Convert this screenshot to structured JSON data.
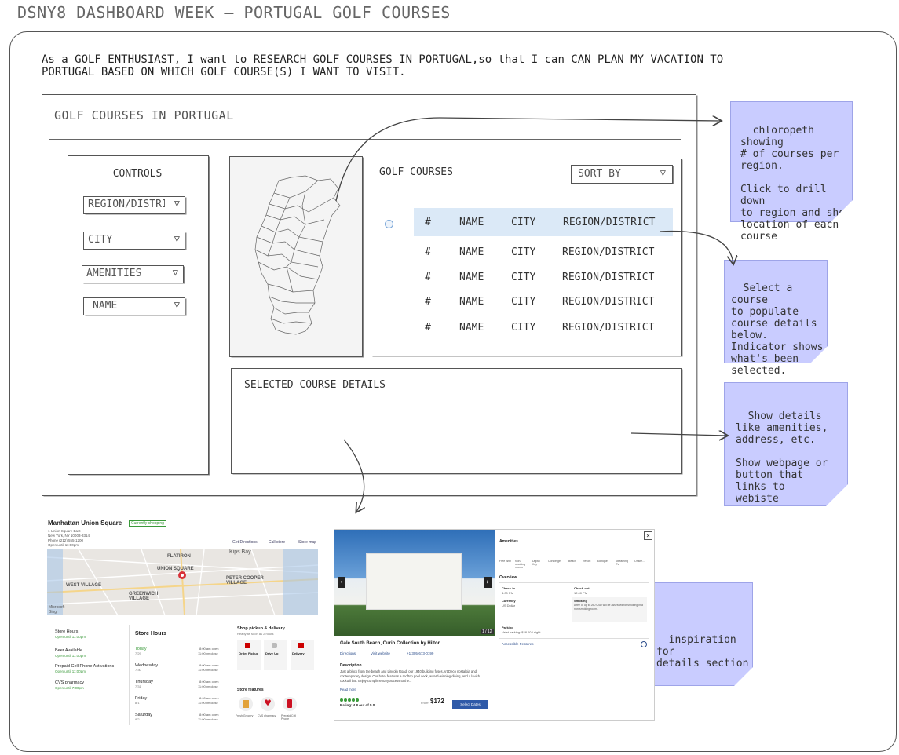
{
  "page_title": "DSNY8 DASHBOARD WEEK – PORTUGAL GOLF COURSES",
  "user_story": "As a GOLF ENTHUSIAST, I want to RESEARCH GOLF COURSES IN PORTUGAL,so that I can CAN PLAN MY VACATION TO\nPORTUGAL BASED ON WHICH GOLF COURSE(S) I WANT TO VISIT.",
  "dashboard": {
    "title": "GOLF COURSES IN PORTUGAL",
    "controls": {
      "title": "CONTROLS",
      "dropdowns": [
        "REGION/DISTRICT",
        "CITY",
        "AMENITIES",
        "NAME"
      ]
    },
    "courses": {
      "title": "GOLF COURSES",
      "sort_label": "SORT BY",
      "columns": [
        "#",
        "NAME",
        "CITY",
        "REGION/DISTRICT"
      ],
      "rows": [
        [
          "#",
          "NAME",
          "CITY",
          "REGION/DISTRICT"
        ],
        [
          "#",
          "NAME",
          "CITY",
          "REGION/DISTRICT"
        ],
        [
          "#",
          "NAME",
          "CITY",
          "REGION/DISTRICT"
        ],
        [
          "#",
          "NAME",
          "CITY",
          "REGION/DISTRICT"
        ],
        [
          "#",
          "NAME",
          "CITY",
          "REGION/DISTRICT"
        ]
      ],
      "selected_row": 0
    },
    "details_title": "SELECTED COURSE DETAILS"
  },
  "notes": {
    "map": "chloropeth showing\n# of courses per\nregion.\n\nClick to drill down\nto region and show\nlocation of each\ncourse",
    "select": "Select a course\nto populate\ncourse details\nbelow.\nIndicator shows\nwhat's been\nselected.",
    "details": "Show details\nlike amenities,\naddress, etc.\n\nShow webpage or\nbutton that\nlinks to\nwebiste",
    "inspiration": "inspiration for\ndetails section"
  },
  "inspiration_store": {
    "title": "Manhattan Union Square",
    "badge": "Currently shopping",
    "address": [
      "1 Union Square East",
      "New York, NY 10003-3314",
      "Phone (212) 555-1200",
      "Open until 11:00pm"
    ],
    "actions": [
      "Get Directions",
      "Call store",
      "Store map"
    ],
    "map_labels": [
      "Kips Bay",
      "FLATIRON",
      "UNION SQUARE",
      "PETER COOPER VILLAGE",
      "WEST VILLAGE",
      "GREENWICH VILLAGE",
      "Microsoft Bing"
    ],
    "sidebar": [
      {
        "name": "Store Hours",
        "status": "Open until 11:00pm"
      },
      {
        "name": "Beer Available",
        "status": "Open until 11:00pm"
      },
      {
        "name": "Prepaid Cell Phone Activations",
        "status": "Open until 11:00pm"
      },
      {
        "name": "CVS pharmacy",
        "status": "Open until 7:00pm"
      }
    ],
    "hours_title": "Store Hours",
    "hours": [
      {
        "day": "Today",
        "date": "7/29",
        "time": "8:00 am open",
        "close": "11:00pm close"
      },
      {
        "day": "Wednesday",
        "date": "7/30",
        "time": "8:00 am open",
        "close": "11:00pm close"
      },
      {
        "day": "Thursday",
        "date": "7/31",
        "time": "8:00 am open",
        "close": "11:00pm close"
      },
      {
        "day": "Friday",
        "date": "8/1",
        "time": "8:00 am open",
        "close": "11:00pm close"
      },
      {
        "day": "Saturday",
        "date": "8/2",
        "time": "8:00 am open",
        "close": "11:00pm close"
      }
    ],
    "pickup_title": "Shop pickup & delivery",
    "pickup_sub": "Ready as soon as 2 hours",
    "pickup_options": [
      "Order Pickup",
      "Drive Up",
      "Delivery"
    ],
    "features_title": "Store features",
    "features": [
      "Fresh Grocery",
      "CVS pharmacy",
      "Prepaid Cell Phone"
    ]
  },
  "inspiration_hotel": {
    "name": "Gale South Beach, Curio Collection by Hilton",
    "links": [
      "Directions",
      "Visit website",
      "+1 305-673-0199"
    ],
    "description_title": "Description",
    "description": "Just a block from the beach and Lincoln Road, our 1940 building fuses Art Deco nostalgia and contemporary design. Our hotel features a rooftop pool deck, award-winning dining, and a lavish cocktail bar. Enjoy complimentary access to the...",
    "read_more": "Read more",
    "rating": "Rating: 4.8 out of 5.0",
    "price": "$172",
    "price_label": "From*",
    "select_button": "Select Dates",
    "photo_counter": "1 / 12",
    "amenities_title": "Amenities",
    "amenities": [
      "Free WiFi",
      "Non-smoking rooms",
      "Digital Key",
      "Concierge",
      "Beach",
      "Resort",
      "Boutique",
      "Streaming TV",
      "Onsite..."
    ],
    "overview_title": "Overview",
    "checkin_label": "Check-in",
    "checkin": "4:00 PM",
    "checkout_label": "Check-out",
    "checkout": "12:00 PM",
    "currency_label": "Currency",
    "currency": "US Dollar",
    "smoking_label": "Smoking",
    "smoking": "A fee of up to 250 USD will be assessed for smoking in a non-smoking room.",
    "parking_label": "Parking",
    "parking": "Valet parking: $48.00 / night",
    "accessible": "Accessible Features"
  }
}
